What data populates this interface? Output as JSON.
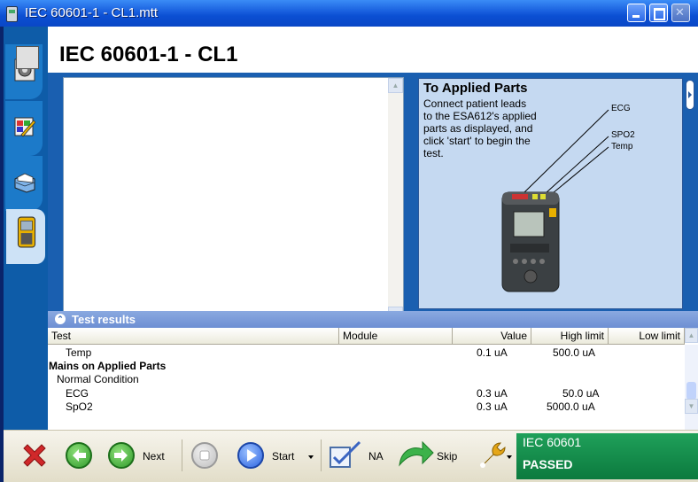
{
  "window": {
    "title": "IEC 60601-1 - CL1.mtt"
  },
  "header": {
    "title": "IEC 60601-1 - CL1"
  },
  "instructions": {
    "title": "To Applied Parts",
    "text": "Connect patient leads\nto the ESA612's applied\nparts as displayed, and\nclick 'start' to begin the\ntest.",
    "labels": {
      "ecg": "ECG",
      "spo2": "SPO2",
      "temp": "Temp"
    }
  },
  "results": {
    "title": "Test results",
    "columns": [
      "Test",
      "Module",
      "Value",
      "High limit",
      "Low limit"
    ],
    "rows": [
      {
        "test": "Temp",
        "indent": 2,
        "bold": false,
        "value": "0.1 uA",
        "high": "500.0 uA"
      },
      {
        "test": "Mains on Applied Parts",
        "indent": 0,
        "bold": true,
        "value": "",
        "high": ""
      },
      {
        "test": "Normal Condition",
        "indent": 1,
        "bold": false,
        "value": "",
        "high": ""
      },
      {
        "test": "ECG",
        "indent": 2,
        "bold": false,
        "value": "0.3 uA",
        "high": "50.0 uA"
      },
      {
        "test": "SpO2",
        "indent": 2,
        "bold": false,
        "value": "0.3 uA",
        "high": "5000.0 uA"
      }
    ]
  },
  "toolbar": {
    "next_label": "Next",
    "start_label": "Start",
    "na_label": "NA",
    "skip_label": "Skip"
  },
  "status": {
    "line1": "IEC 60601",
    "line2": "PASSED"
  },
  "colors": {
    "accent": "#1a5fb0",
    "sidebar": "#0e5ca8",
    "passed": "#0c7a3e"
  }
}
